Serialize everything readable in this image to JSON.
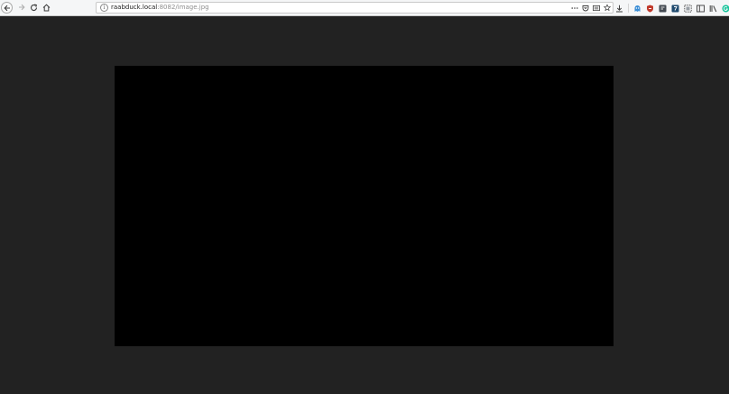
{
  "browser": {
    "url": {
      "host": "raabduck.local",
      "rest": ":8082/image.jpg"
    },
    "icons": {
      "back": "back-arrow-icon",
      "forward": "forward-arrow-icon",
      "reload": "reload-icon",
      "home": "home-icon",
      "site_info": "info-icon",
      "page_actions": "more-icon",
      "pocket": "pocket-icon",
      "reader": "reader-view-icon",
      "bookmark": "bookmark-star-icon",
      "download": "download-icon",
      "extensions": [
        "ghostery-icon",
        "ublock-icon",
        "extension-icon",
        "extension-icon",
        "screenshot-icon",
        "sidebar-icon",
        "library-icon",
        "grammarly-icon"
      ],
      "menu": "hamburger-menu-icon"
    },
    "colors": {
      "toolbar_bg": "#f5f6f7",
      "page_bg": "#222222",
      "image_bg": "#000000",
      "ublock_red": "#c0392b",
      "grammarly_green": "#15c39a"
    }
  }
}
